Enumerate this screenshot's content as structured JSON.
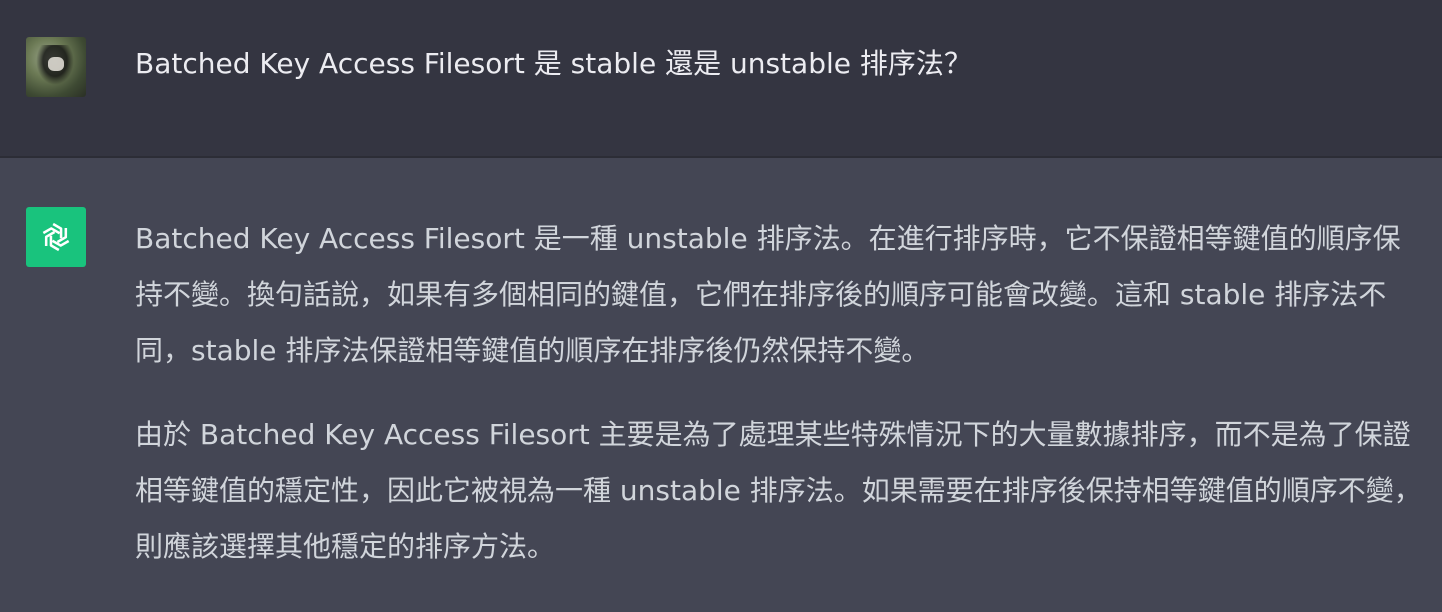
{
  "user": {
    "avatar_icon": "user-avatar-photo",
    "message": "Batched Key Access Filesort 是 stable 還是 unstable 排序法？"
  },
  "assistant": {
    "avatar_icon": "openai-logo-icon",
    "avatar_color": "#19c37d",
    "paragraphs": [
      "Batched Key Access Filesort 是一種 unstable 排序法。在進行排序時，它不保證相等鍵值的順序保持不變。換句話說，如果有多個相同的鍵值，它們在排序後的順序可能會改變。這和 stable 排序法不同，stable 排序法保證相等鍵值的順序在排序後仍然保持不變。",
      "由於 Batched Key Access Filesort 主要是為了處理某些特殊情況下的大量數據排序，而不是為了保證相等鍵值的穩定性，因此它被視為一種 unstable 排序法。如果需要在排序後保持相等鍵值的順序不變，則應該選擇其他穩定的排序方法。"
    ]
  },
  "colors": {
    "user_bg": "#343541",
    "assistant_bg": "#444654",
    "text": "#d1d5db"
  }
}
